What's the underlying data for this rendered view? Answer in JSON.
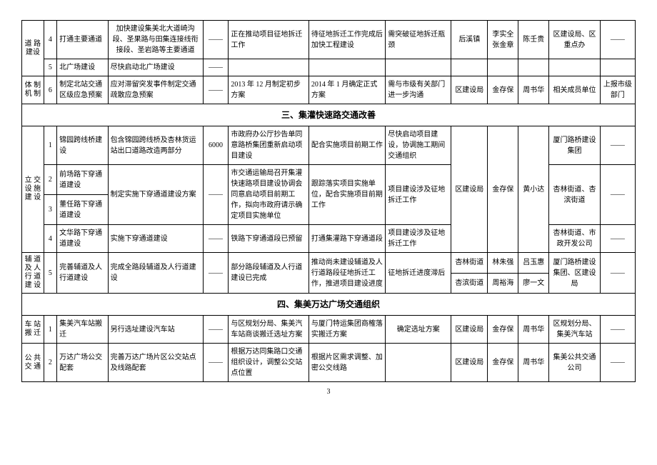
{
  "rows": {
    "r4": {
      "cat": "道 路\n建设",
      "no": "4",
      "name": "打通主要通道",
      "content": "加快建设集美北大道崎沟段、圣果路与田集连接线衔接段、圣岩路等主要通道",
      "num": "——",
      "progress": "正在推动项目征地拆迁工作",
      "q1": "待征地拆迁工作完成后加快工程建设",
      "q2": "需突破征地拆迁瓶颈",
      "unit": "后溪镇",
      "p1": "李实全\n张金章",
      "p2": "陈壬贵",
      "coop": "区建设局、区重点办",
      "note": "——"
    },
    "r5": {
      "no": "5",
      "name": "北广场建设",
      "content": "尽快启动北广场建设",
      "num": "——",
      "progress": "",
      "q1": "",
      "q2": "",
      "unit": "",
      "p1": "",
      "p2": "",
      "coop": "",
      "note": ""
    },
    "r6": {
      "cat": "体 制\n机 制",
      "no": "6",
      "name": "制定北站交通区级应急预案",
      "content": "应对滞留突发事件制定交通疏散应急预案",
      "num": "——",
      "progress": "2013 年 12 月制定初步方案",
      "q1": "2014 年 1 月确定正式方案",
      "q2": "需与市级有关部门进一步沟通",
      "unit": "区建设局",
      "p1": "金存保",
      "p2": "周书华",
      "coop": "相关成员单位",
      "note": "上报市级部门"
    },
    "s3": {
      "title": "三、集灌快速路交通改善"
    },
    "j1": {
      "no": "1",
      "name": "锦园跨线桥建设",
      "content": "包含锦园跨线桥及杏林货运站出口道路改造两部分",
      "num": "6000",
      "progress": "市政府办公厅抄告单同意路桥集团重新启动项目建设",
      "q1": "配合实施项目前期工作",
      "q2": "尽快启动项目建设，协调施工期间交通组织",
      "coop": "厦门路桥建设集团",
      "note": "——"
    },
    "jcat": "立 交\n设 施\n建 设",
    "j2": {
      "no": "2",
      "name": "前场路下穿通道建设",
      "content": "制定实施下穿通道建设方案",
      "num": "——",
      "progress": "市交通运输局召开集灌快速路项目建设协调会同意启动项目前期工作，拟向市政府请示确定项目实施单位",
      "q1": "跟踪落实项目实施单位，配合实施项目前期工作",
      "q2": "项目建设涉及征地拆迁工作",
      "unit": "区建设局",
      "p1": "金存保",
      "p2": "黄小达",
      "coop": "杏林街道、杏滨街道",
      "note": "——"
    },
    "j3": {
      "no": "3",
      "name": "董任路下穿通道建设"
    },
    "j4": {
      "no": "4",
      "name": "文华路下穿通道建设",
      "content": "实施下穿通道建设",
      "num": "——",
      "progress": "铁路下穿通道段已预留",
      "q1": "打通集灌路下穿通道段",
      "q2": "项目建设涉及征地拆迁工作",
      "coop": "杏林街道、市政开发公司",
      "note": "——"
    },
    "j5cat": "辅 道\n及 人\n行 道\n建 设",
    "j5": {
      "no": "5",
      "name": "完善辅道及人行道建设",
      "content": "完成全路段辅道及人行道建设",
      "num": "——",
      "progress": "部分路段辅道及人行道建设已完成",
      "q1": "推动尚未建设辅道及人行道路段征地拆迁工作，推进项目建设进度",
      "q2": "征地拆迁进度滞后",
      "unit1": "杏林街道",
      "p1a": "林朱强",
      "p2a": "吕玉惠",
      "coop": "厦门路桥建设集团、区建设局",
      "note": "——",
      "unit2": "杏滨街道",
      "p1b": "周裕海",
      "p2b": "廖一文"
    },
    "s4": {
      "title": "四、集美万达广场交通组织"
    },
    "w1": {
      "cat": "车 站\n搬 迁",
      "no": "1",
      "name": "集美汽车站搬迁",
      "content": "另行选址建设汽车站",
      "num": "——",
      "progress": "与区规划分局、集美汽车站商谈搬迁选址方案",
      "q1": "与厦门特运集团商榷落实搬迁方案",
      "q2": "确定选址方案",
      "unit": "区建设局",
      "p1": "金存保",
      "p2": "周书华",
      "coop": "区规划分局、集美汽车站",
      "note": "——"
    },
    "w2": {
      "cat": "公 共\n交 通",
      "no": "2",
      "name": "万达广场公交配套",
      "content": "完善万达广场片区公交站点及线路配套",
      "num": "——",
      "progress": "根据万达同集路口交通组织设计，调整公交站点位置",
      "q1": "根据片区需求调整、加密公交线路",
      "q2": "",
      "unit": "区建设局",
      "p1": "金存保",
      "p2": "周书华",
      "coop": "集美公共交通公司",
      "note": "——"
    }
  },
  "page_number": "3"
}
